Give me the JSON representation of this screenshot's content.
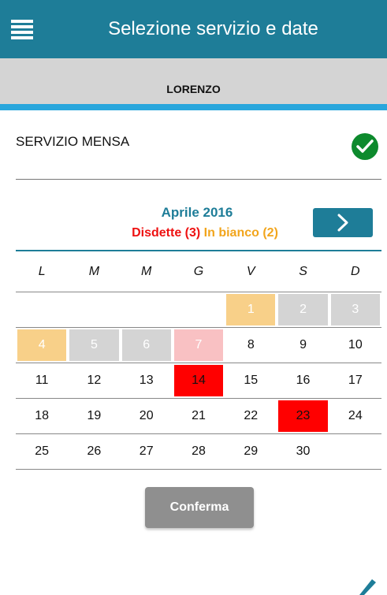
{
  "app_bar": {
    "title": "Selezione servizio e date",
    "menu_icon": "hamburger-menu-icon"
  },
  "student": {
    "name": "LORENZO"
  },
  "service": {
    "label": "SERVIZIO MENSA",
    "status_icon": "check-circle-icon",
    "selected": true
  },
  "calendar": {
    "month_title": "Aprile 2016",
    "legend": {
      "cancellations": "Disdette (3)",
      "white_meals": "In bianco (2)"
    },
    "next_icon": "chevron-right-icon",
    "weekdays": [
      "L",
      "M",
      "M",
      "G",
      "V",
      "S",
      "D"
    ],
    "weeks": [
      [
        {
          "day": "",
          "state": "empty"
        },
        {
          "day": "",
          "state": "empty"
        },
        {
          "day": "",
          "state": "empty"
        },
        {
          "day": "",
          "state": "empty"
        },
        {
          "day": "1",
          "state": "tentative"
        },
        {
          "day": "2",
          "state": "holiday"
        },
        {
          "day": "3",
          "state": "holiday"
        }
      ],
      [
        {
          "day": "4",
          "state": "tentative"
        },
        {
          "day": "5",
          "state": "holiday"
        },
        {
          "day": "6",
          "state": "holiday"
        },
        {
          "day": "7",
          "state": "pending"
        },
        {
          "day": "8",
          "state": "normal"
        },
        {
          "day": "9",
          "state": "normal"
        },
        {
          "day": "10",
          "state": "normal"
        }
      ],
      [
        {
          "day": "11",
          "state": "normal"
        },
        {
          "day": "12",
          "state": "normal"
        },
        {
          "day": "13",
          "state": "normal"
        },
        {
          "day": "14",
          "state": "cancelled"
        },
        {
          "day": "15",
          "state": "normal"
        },
        {
          "day": "16",
          "state": "normal"
        },
        {
          "day": "17",
          "state": "normal"
        }
      ],
      [
        {
          "day": "18",
          "state": "normal"
        },
        {
          "day": "19",
          "state": "normal"
        },
        {
          "day": "20",
          "state": "normal"
        },
        {
          "day": "21",
          "state": "normal"
        },
        {
          "day": "22",
          "state": "normal"
        },
        {
          "day": "23",
          "state": "cancelled"
        },
        {
          "day": "24",
          "state": "normal"
        }
      ],
      [
        {
          "day": "25",
          "state": "normal"
        },
        {
          "day": "26",
          "state": "normal"
        },
        {
          "day": "27",
          "state": "normal"
        },
        {
          "day": "28",
          "state": "normal"
        },
        {
          "day": "29",
          "state": "normal"
        },
        {
          "day": "30",
          "state": "normal"
        },
        {
          "day": "",
          "state": "empty"
        }
      ]
    ]
  },
  "actions": {
    "confirm_label": "Conferma",
    "edit_icon": "pencil-icon"
  },
  "colors": {
    "primary": "#1e7d98",
    "accent_line": "#29a6dc",
    "cancel_red": "#ff0000",
    "legend_red": "#ee1111",
    "white_meal_orange": "#f2a51c",
    "tentative_peach": "#f8d089",
    "holiday_gray": "#d4d4d4",
    "pending_pink": "#f9c1c3",
    "success_green": "#0d8a2d"
  }
}
